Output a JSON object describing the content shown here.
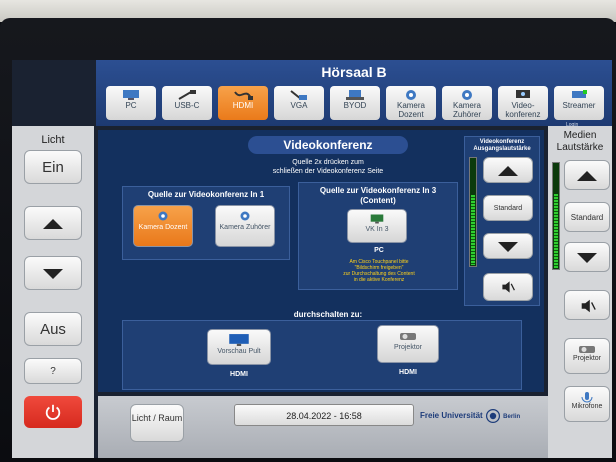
{
  "header": {
    "title": "Hörsaal B"
  },
  "sources": [
    {
      "label": "PC",
      "icon": "pc-icon"
    },
    {
      "label": "USB-C",
      "icon": "usb-c-cable-icon"
    },
    {
      "label": "HDMI",
      "icon": "hdmi-cable-icon",
      "active": true
    },
    {
      "label": "VGA",
      "icon": "vga-cable-icon"
    },
    {
      "label": "BYOD",
      "icon": "laptop-icon"
    },
    {
      "label": "Kamera Dozent",
      "icon": "camera-icon"
    },
    {
      "label": "Kamera Zuhörer",
      "icon": "camera-icon"
    },
    {
      "label": "Video-konferenz",
      "icon": "videoconference-icon"
    },
    {
      "label": "Streamer",
      "icon": "streamer-icon",
      "sub": "Login"
    }
  ],
  "left": {
    "header": "Licht",
    "on": "Ein",
    "off": "Aus",
    "help": "?"
  },
  "right": {
    "header_line1": "Medien",
    "header_line2": "Lautstärke",
    "standard": "Standard",
    "projector": "Projektor",
    "microphone": "Mikrofone"
  },
  "main": {
    "title": "Videokonferenz",
    "instruction_line1": "Quelle 2x drücken zum",
    "instruction_line2": "schließen der Videokonferenz Seite",
    "vk_in1": {
      "title": "Quelle zur Videokonferenz In 1",
      "btn1": "Kamera Dozent",
      "btn2": "Kamera Zuhörer"
    },
    "vk_in3": {
      "title_line1": "Quelle zur Videokonferenz In 3",
      "title_line2": "(Content)",
      "btn": "VK In 3",
      "source": "PC",
      "note": [
        "Am Cisco Touchpanel bitte",
        "\"Bildschirm freigeben\"",
        "zur Durchschaltung des Content",
        "in die aktive Konferenz"
      ]
    },
    "vk_volume": {
      "title_line1": "Videokonferenz",
      "title_line2": "Ausgangslautstärke",
      "standard": "Standard",
      "level": 0.65
    },
    "switch": {
      "title": "durchschalten zu:",
      "dest1": "Vorschau Pult",
      "dest1_sub": "HDMI",
      "dest2": "Projektor",
      "dest2_sub": "HDMI"
    }
  },
  "media_level": 0.7,
  "bottom": {
    "light_room": "Licht / Raum",
    "date": "28.04.2022",
    "sep": "-",
    "time": "16:58",
    "brand": "Freie Universität",
    "brand2": "Berlin"
  }
}
